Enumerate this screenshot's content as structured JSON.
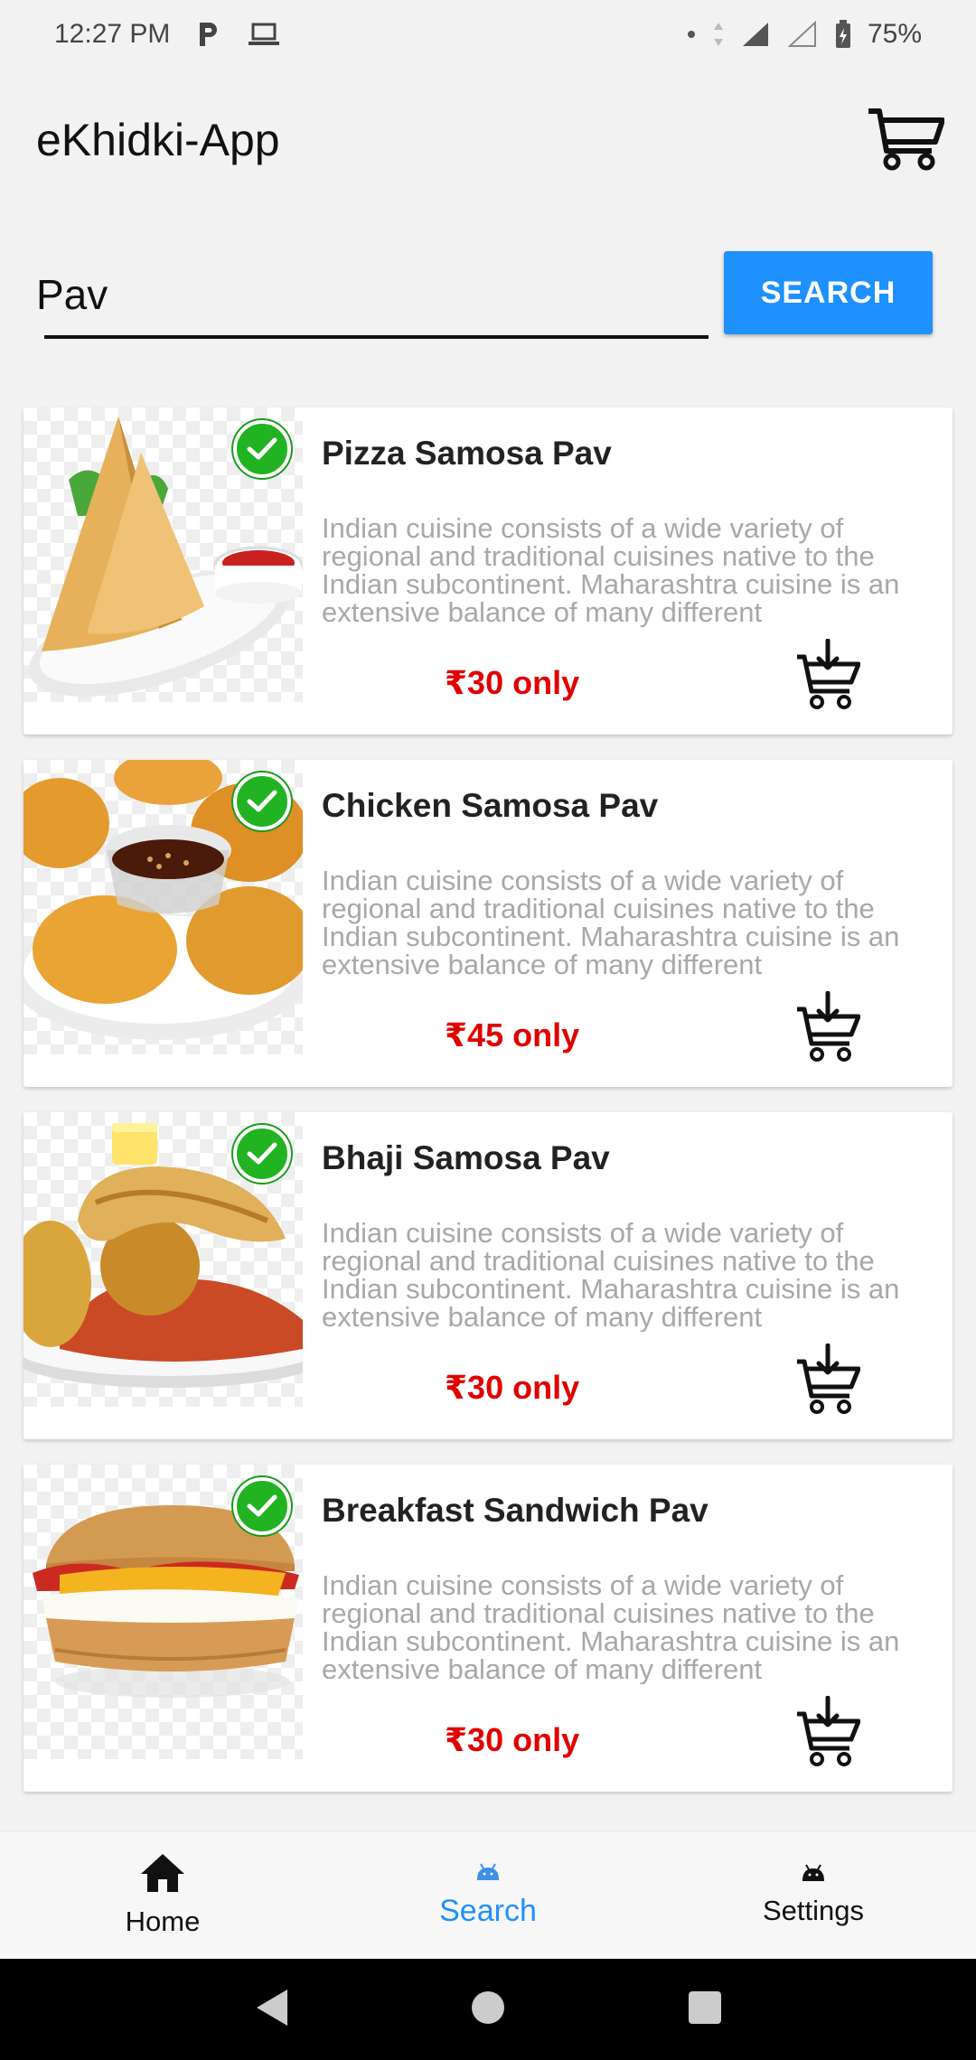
{
  "status_bar": {
    "time": "12:27 PM",
    "battery": "75%"
  },
  "app": {
    "title": "eKhidki-App"
  },
  "search": {
    "value": "Pav",
    "placeholder": "",
    "button_label": "SEARCH"
  },
  "items": [
    {
      "title": "Pizza Samosa Pav",
      "description": "Indian cuisine consists of a wide variety of regional and traditional cuisines native to the Indian subcontinent. Maharashtra cuisine is an extensive balance of many different",
      "price": "₹30 only"
    },
    {
      "title": "Chicken Samosa Pav",
      "description": "Indian cuisine consists of a wide variety of regional and traditional cuisines native to the Indian subcontinent. Maharashtra cuisine is an extensive balance of many different",
      "price": "₹45 only"
    },
    {
      "title": "Bhaji Samosa Pav",
      "description": "Indian cuisine consists of a wide variety of regional and traditional cuisines native to the Indian subcontinent. Maharashtra cuisine is an extensive balance of many different",
      "price": "₹30 only"
    },
    {
      "title": "Breakfast Sandwich Pav",
      "description": "Indian cuisine consists of a wide variety of regional and traditional cuisines native to the Indian subcontinent. Maharashtra cuisine is an extensive balance of many different",
      "price": "₹30 only"
    }
  ],
  "bottom_nav": {
    "home": "Home",
    "search": "Search",
    "settings": "Settings"
  },
  "colors": {
    "accent": "#1e90ff",
    "price": "#e00000",
    "check": "#22b322"
  },
  "icons": {
    "cart": "cart-icon",
    "add_to_cart": "cart-add-icon",
    "check": "check-icon",
    "home": "home-icon",
    "search": "android-icon",
    "settings": "android-icon"
  }
}
